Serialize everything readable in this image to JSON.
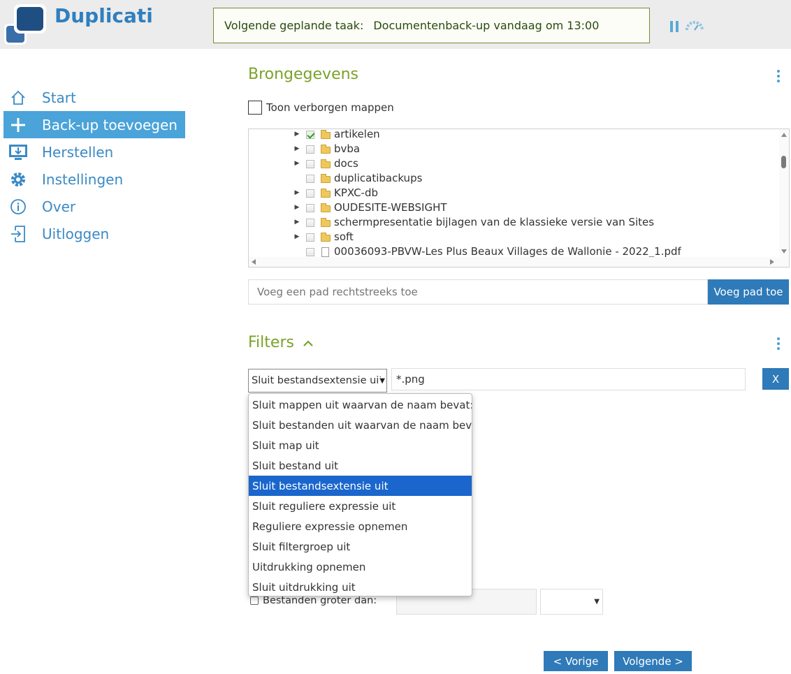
{
  "app": {
    "name": "Duplicati"
  },
  "next_task": {
    "label": "Volgende geplande taak:",
    "value": "Documentenback-up vandaag om 13:00"
  },
  "toolbar_icons": [
    "pause-icon",
    "throttle-icon"
  ],
  "sidebar": {
    "items": [
      {
        "label": "Start",
        "icon": "home-icon",
        "active": false
      },
      {
        "label": "Back-up toevoegen",
        "icon": "plus-icon",
        "active": true
      },
      {
        "label": "Herstellen",
        "icon": "restore-icon",
        "active": false
      },
      {
        "label": "Instellingen",
        "icon": "gear-icon",
        "active": false
      },
      {
        "label": "Over",
        "icon": "info-icon",
        "active": false
      },
      {
        "label": "Uitloggen",
        "icon": "logout-icon",
        "active": false
      }
    ]
  },
  "source": {
    "title": "Brongegevens",
    "show_hidden_label": "Toon verborgen mappen",
    "tree": [
      {
        "name": "artikelen",
        "type": "folder",
        "expandable": true,
        "checked": true
      },
      {
        "name": "bvba",
        "type": "folder",
        "expandable": true,
        "checked": false
      },
      {
        "name": "docs",
        "type": "folder",
        "expandable": true,
        "checked": false
      },
      {
        "name": "duplicatibackups",
        "type": "folder",
        "expandable": false,
        "checked": false
      },
      {
        "name": "KPXC-db",
        "type": "folder",
        "expandable": true,
        "checked": false
      },
      {
        "name": "OUDESITE-WEBSIGHT",
        "type": "folder",
        "expandable": true,
        "checked": false
      },
      {
        "name": "schermpresentatie bijlagen van de klassieke versie van Sites",
        "type": "folder",
        "expandable": true,
        "checked": false
      },
      {
        "name": "soft",
        "type": "folder",
        "expandable": true,
        "checked": false
      },
      {
        "name": "00036093-PBVW-Les Plus Beaux Villages de Wallonie - 2022_1.pdf",
        "type": "file",
        "expandable": false,
        "checked": false
      }
    ],
    "path_placeholder": "Voeg een pad rechtstreeks toe",
    "add_path_button": "Voeg pad toe"
  },
  "filters": {
    "title": "Filters",
    "selected_type": "Sluit bestandsextensie uit",
    "value": "*.png",
    "remove_button": "X",
    "options": [
      "Sluit mappen uit waarvan de naam bevat:",
      "Sluit bestanden uit waarvan de naam bevat:",
      "Sluit map uit",
      "Sluit bestand uit",
      "Sluit bestandsextensie uit",
      "Sluit reguliere expressie uit",
      "Reguliere expressie opnemen",
      "Sluit filtergroep uit",
      "Uitdrukking opnemen",
      "Sluit uitdrukking uit"
    ],
    "highlighted_index": 4,
    "larger_than_label": "Bestanden groter dan:"
  },
  "navigation": {
    "prev_button": "< Vorige",
    "next_button": "Volgende >"
  },
  "colors": {
    "brand": "#2f7fbf",
    "accent_green": "#7aa22a",
    "button_blue": "#2f7ab8",
    "nav_active": "#4aa3d9",
    "option_highlight": "#1a66cc"
  }
}
